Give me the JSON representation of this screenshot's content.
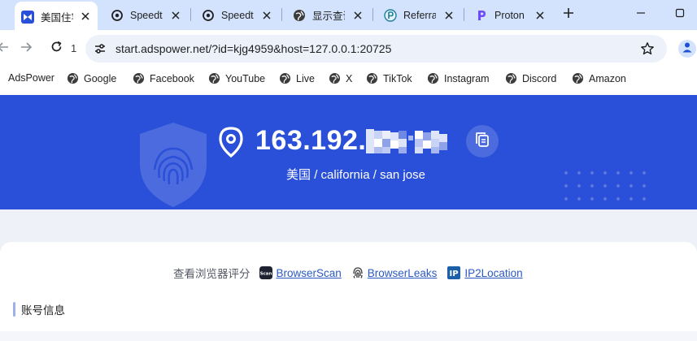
{
  "tabs": [
    {
      "title": "美国住宅",
      "icon": "adspower-logo-icon"
    },
    {
      "title": "Speedtest",
      "icon": "speedtest-icon"
    },
    {
      "title": "Speedtest",
      "icon": "speedtest-icon"
    },
    {
      "title": "显示查询",
      "icon": "globe-icon"
    },
    {
      "title": "Referral",
      "icon": "referral-icon"
    },
    {
      "title": "Proton",
      "icon": "proton-icon"
    }
  ],
  "toolbar": {
    "reload_number": "1",
    "url": "start.adspower.net/?id=kjg4959&host=127.0.0.1:20725"
  },
  "bookmarks": [
    "AdsPower",
    "Google",
    "Facebook",
    "YouTube",
    "Live",
    "X",
    "TikTok",
    "Instagram",
    "Discord",
    "Amazon"
  ],
  "hero": {
    "ip": "163.192.",
    "location": "美国 / california / san jose"
  },
  "check": {
    "label": "查看浏览器评分",
    "links": [
      "BrowserScan",
      "BrowserLeaks",
      "IP2Location"
    ]
  },
  "section": {
    "title": "账号信息"
  },
  "colors": {
    "accent": "#2a4fd8",
    "tabstrip": "#d3e3fd",
    "link": "#2b59c3"
  }
}
